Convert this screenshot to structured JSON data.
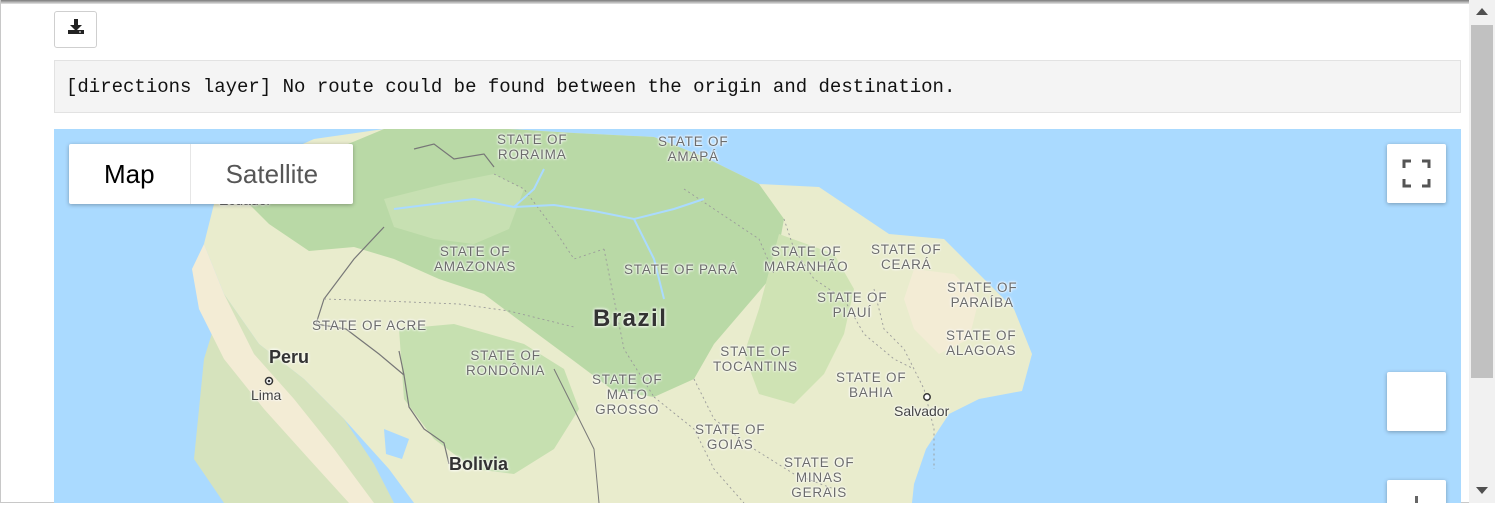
{
  "output": {
    "download_icon": "download-icon",
    "message": "[directions layer] No route could be found between the origin and destination."
  },
  "map": {
    "type_control": {
      "map_label": "Map",
      "satellite_label": "Satellite",
      "selected": "Map"
    },
    "fullscreen_icon": "fullscreen-icon",
    "countries": {
      "brazil": "Brazil",
      "peru": "Peru",
      "bolivia": "Bolivia"
    },
    "partial_label": "Ecuador",
    "states": {
      "roraima": [
        "STATE OF",
        "RORAIMA"
      ],
      "amapa": [
        "STATE OF",
        "AMAPÁ"
      ],
      "amazonas": [
        "STATE OF",
        "AMAZONAS"
      ],
      "para": [
        "STATE OF PARÁ"
      ],
      "maranhao": [
        "STATE OF",
        "MARANHÃO"
      ],
      "ceara": [
        "STATE OF",
        "CEARÁ"
      ],
      "piaui": [
        "STATE OF",
        "PIAUÍ"
      ],
      "paraiba": [
        "STATE OF",
        "PARAÍBA"
      ],
      "acre": [
        "STATE OF ACRE"
      ],
      "alagoas": [
        "STATE OF",
        "ALAGOAS"
      ],
      "rondonia": [
        "STATE OF",
        "RONDÔNIA"
      ],
      "tocantins": [
        "STATE OF",
        "TOCANTINS"
      ],
      "mato_grosso": [
        "STATE OF",
        "MATO",
        "GROSSO"
      ],
      "bahia": [
        "STATE OF",
        "BAHIA"
      ],
      "goias": [
        "STATE OF",
        "GOIÁS"
      ],
      "minas_gerais": [
        "STATE OF",
        "MINAS",
        "GERAIS"
      ]
    },
    "cities": {
      "lima": "Lima",
      "salvador": "Salvador"
    },
    "colors": {
      "ocean": "#aadaff",
      "forest": "#b9d9a6",
      "land": "#e9eccd",
      "highland": "#cfe3b4",
      "desert": "#f3ecd5"
    }
  }
}
